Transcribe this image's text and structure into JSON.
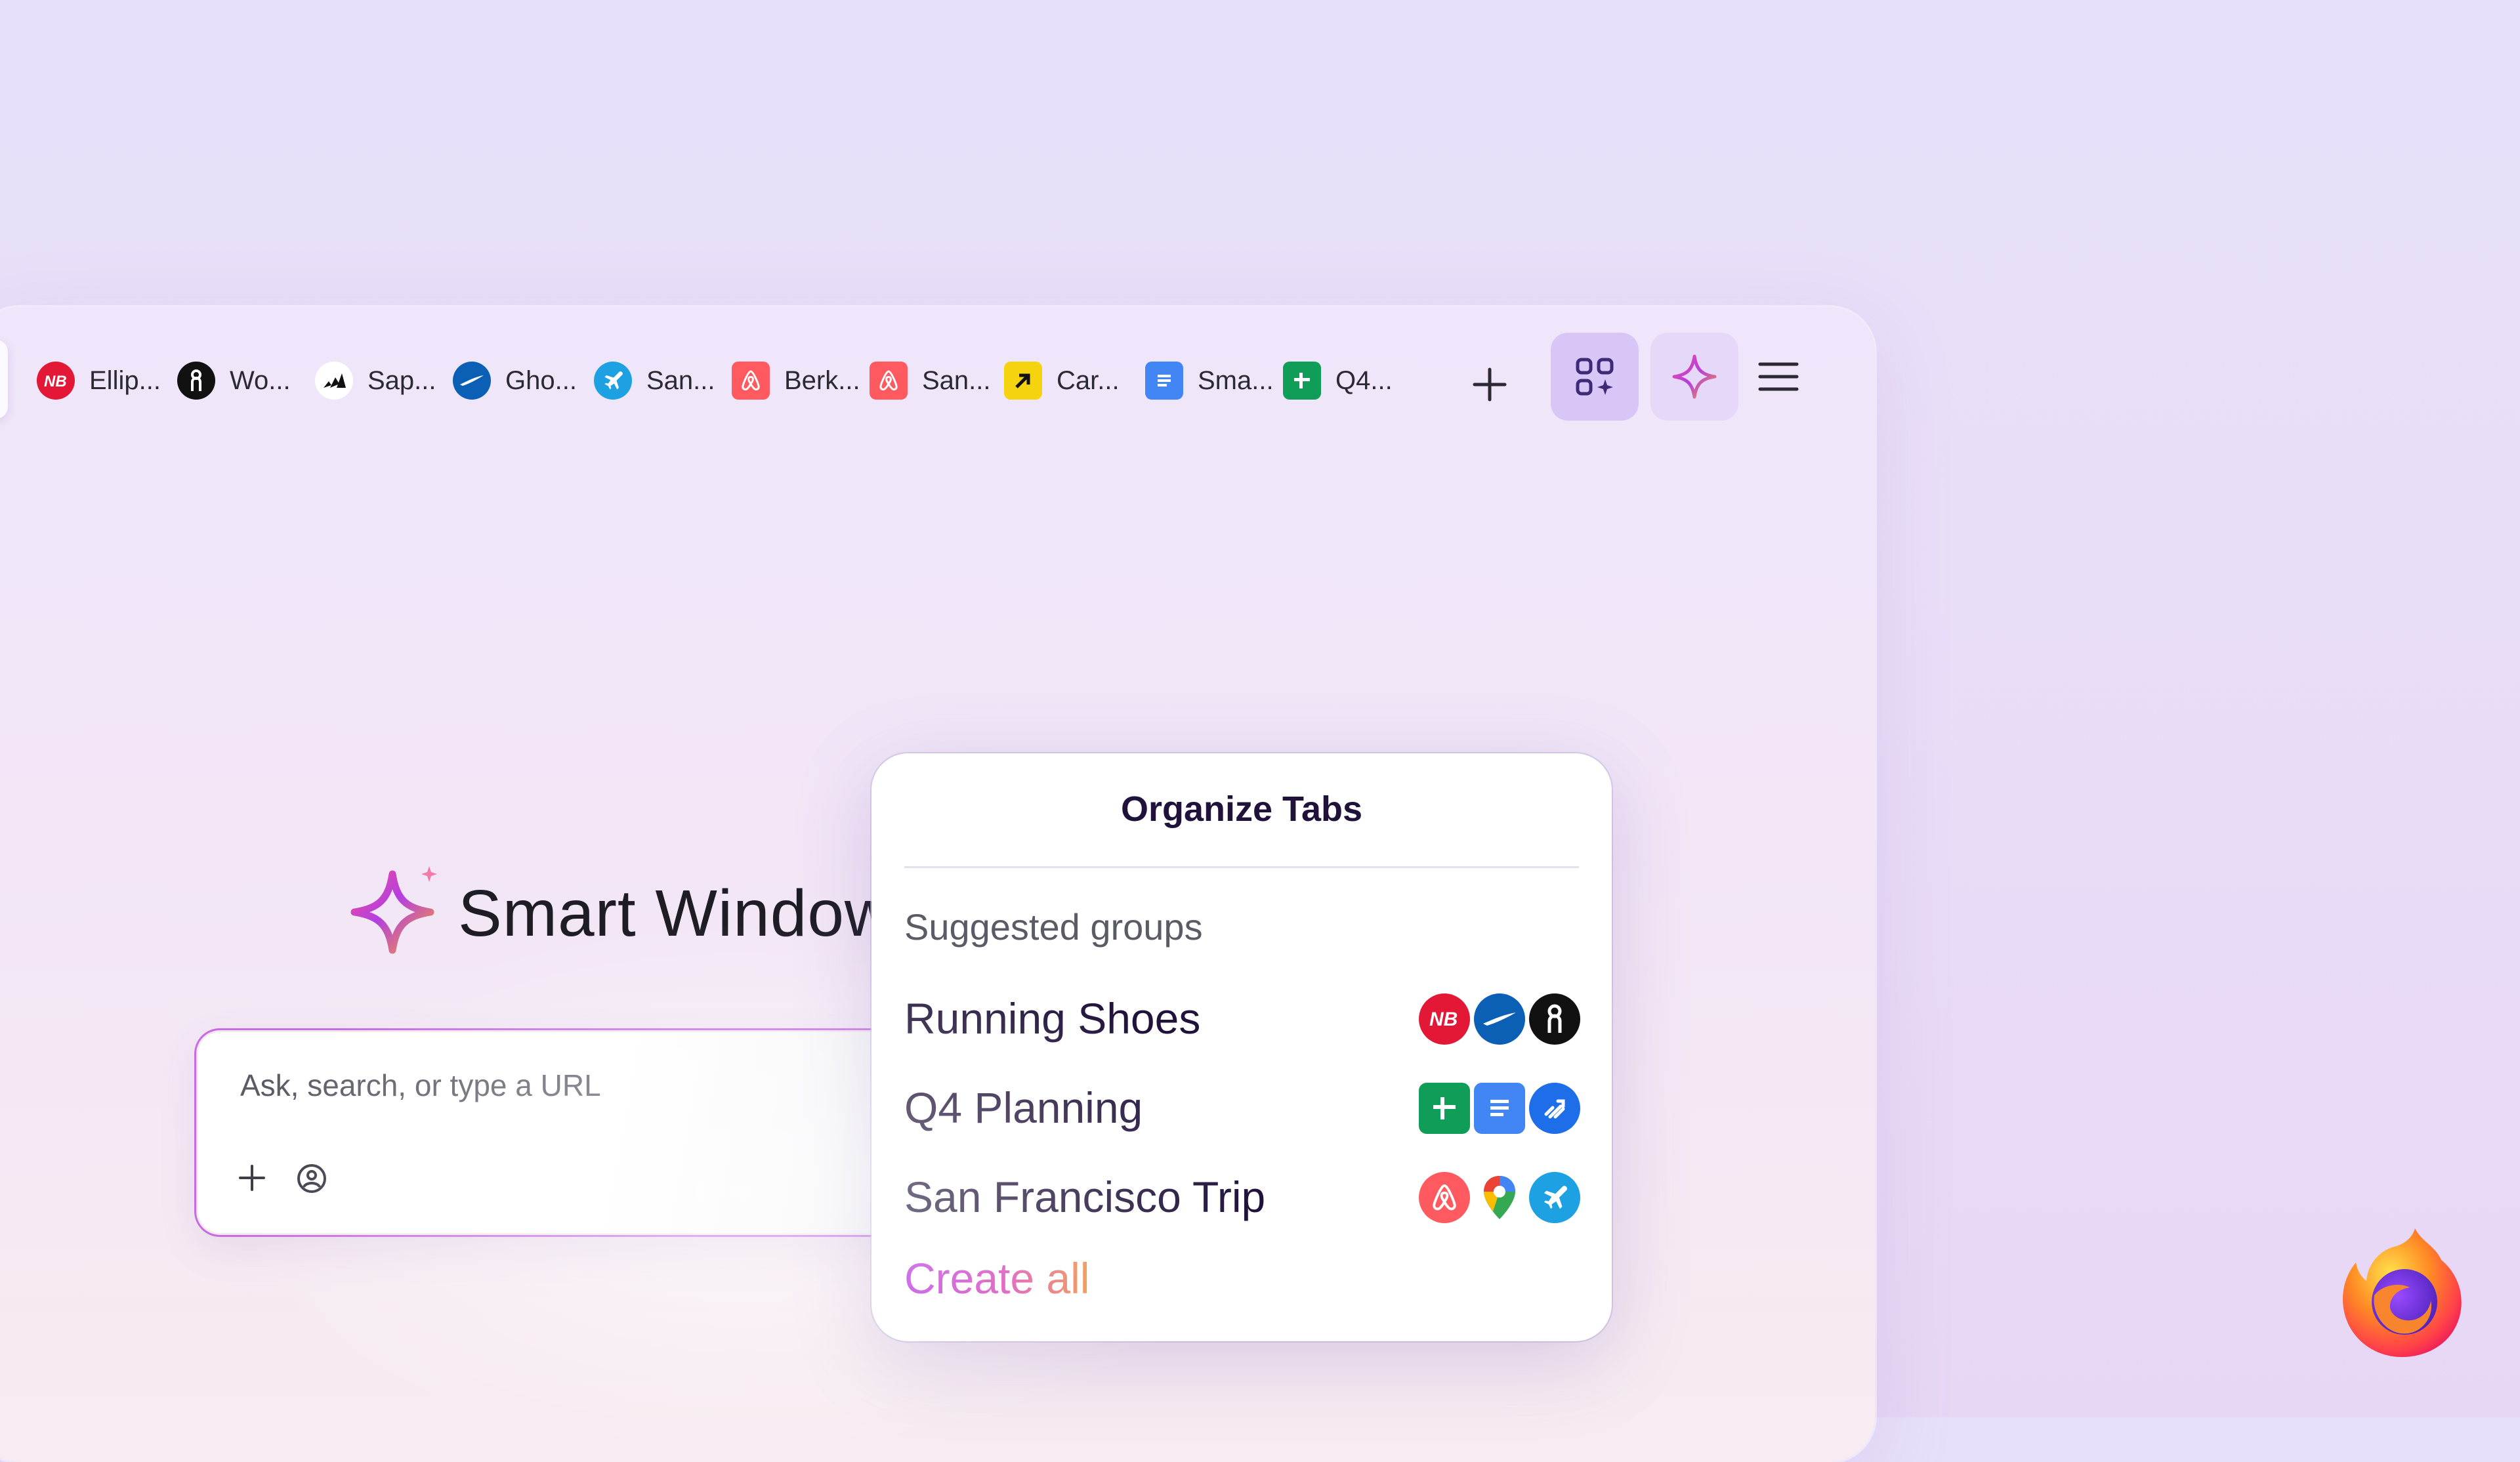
{
  "tabs": [
    {
      "label": "Ellip...",
      "icon": "new-balance-icon",
      "color": "#e21836"
    },
    {
      "label": "Wo...",
      "icon": "on-running-icon",
      "color": "#111111"
    },
    {
      "label": "Sap...",
      "icon": "adidas-icon",
      "color": "#ffffff"
    },
    {
      "label": "Gho...",
      "icon": "brooks-icon",
      "color": "#0b5fb4"
    },
    {
      "label": "San...",
      "icon": "flight-icon",
      "color": "#1da1e3"
    },
    {
      "label": "Berk...",
      "icon": "airbnb-icon",
      "color": "#ff5a5f"
    },
    {
      "label": "San...",
      "icon": "airbnb-icon",
      "color": "#ff5a5f"
    },
    {
      "label": "Car...",
      "icon": "arrow-app-icon",
      "color": "#f5d30f"
    },
    {
      "label": "Sma...",
      "icon": "google-docs-icon",
      "color": "#4285f4"
    },
    {
      "label": "Q4...",
      "icon": "google-sheets-icon",
      "color": "#0f9d58"
    }
  ],
  "toolbar": {
    "new_tab_icon": "plus-icon",
    "organize_icon": "organize-tabs-icon",
    "ai_icon": "sparkle-icon",
    "menu_icon": "hamburger-menu-icon"
  },
  "hero": {
    "title": "Smart Window"
  },
  "urlbar": {
    "placeholder": "Ask, search, or type a URL",
    "add_icon": "plus-icon",
    "persona_icon": "persona-icon",
    "send_icon": "arrow-right-icon"
  },
  "organize_panel": {
    "title": "Organize Tabs",
    "section_label": "Suggested groups",
    "groups": [
      {
        "name": "Running Shoes",
        "icons": [
          "new-balance-icon",
          "brooks-icon",
          "on-running-icon"
        ]
      },
      {
        "name": "Q4 Planning",
        "icons": [
          "google-sheets-icon",
          "google-docs-icon",
          "jira-icon"
        ]
      },
      {
        "name": "San Francisco Trip",
        "icons": [
          "airbnb-icon",
          "google-maps-icon",
          "flight-icon"
        ]
      }
    ],
    "create_all_label": "Create all"
  },
  "brand": {
    "logo": "firefox-logo",
    "accent": "#b833e1"
  }
}
